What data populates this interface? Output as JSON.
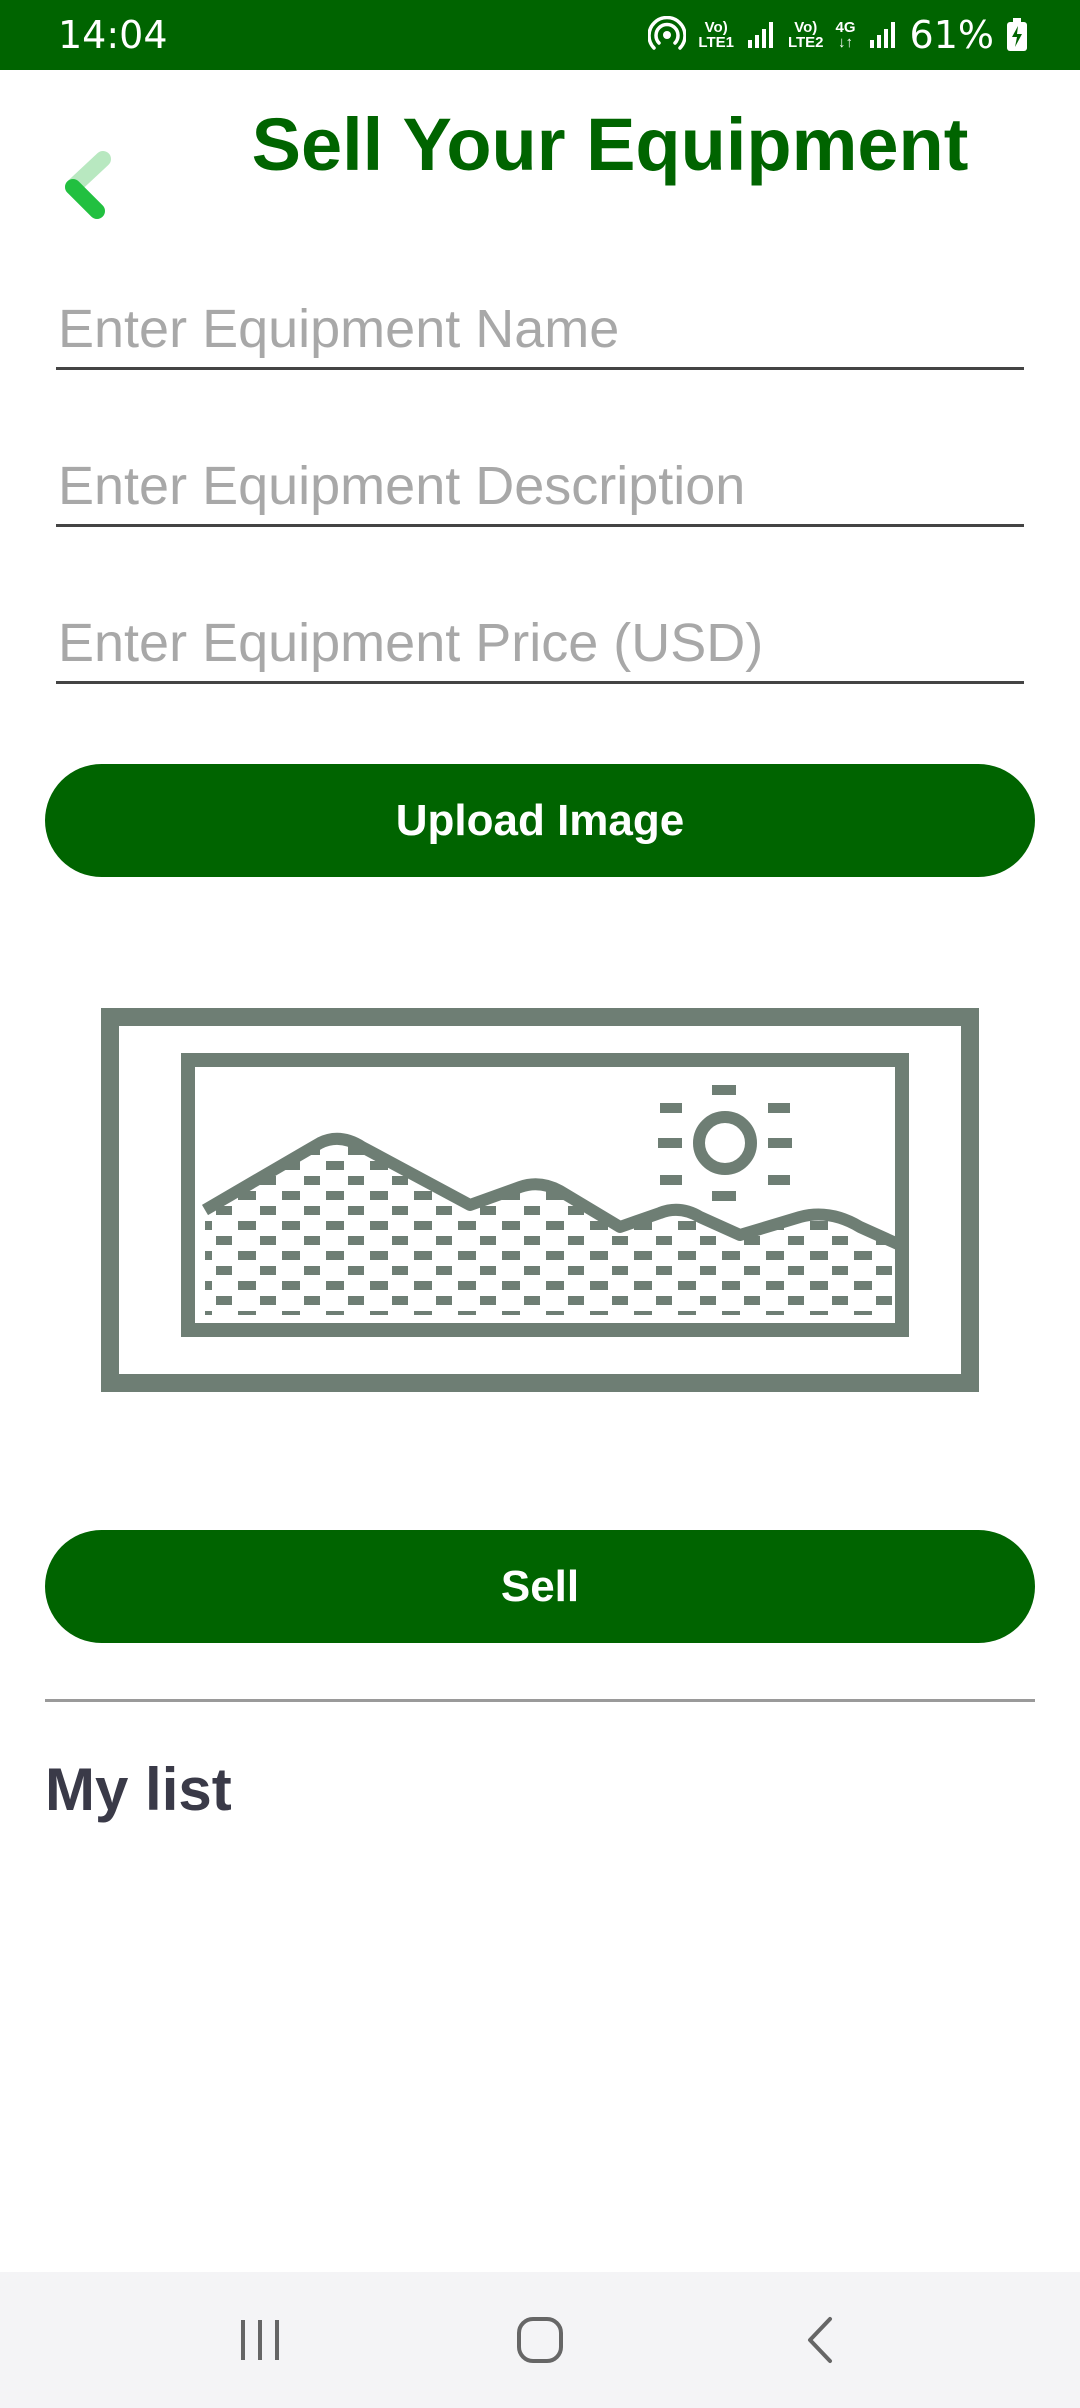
{
  "status_bar": {
    "time": "14:04",
    "signal_sim1": {
      "top": "Vo)",
      "bottom": "LTE1"
    },
    "signal_sim2": {
      "top": "Vo)",
      "bottom": "LTE2"
    },
    "network": "4G",
    "battery": "61%",
    "icons": [
      "hotspot-icon",
      "signal-bars-icon",
      "battery-charging-icon"
    ]
  },
  "header": {
    "title": "Sell Your Equipment",
    "back_icon": "chevron-left-icon"
  },
  "form": {
    "name_placeholder": "Enter Equipment Name",
    "description_placeholder": "Enter Equipment Description",
    "price_placeholder": "Enter Equipment Price (USD)",
    "upload_label": "Upload Image",
    "image_icon": "image-placeholder-icon",
    "sell_label": "Sell"
  },
  "my_list": {
    "title": "My list"
  },
  "nav_bar": {
    "icons": [
      "recent-apps-icon",
      "home-icon",
      "back-icon"
    ]
  },
  "colors": {
    "primary": "#006400",
    "status_bar": "#006400",
    "back_chevron": "#22c040",
    "placeholder_text": "#a8a8a8",
    "image_placeholder": "#6e7e74",
    "nav_bar_bg": "#f4f4f6"
  }
}
